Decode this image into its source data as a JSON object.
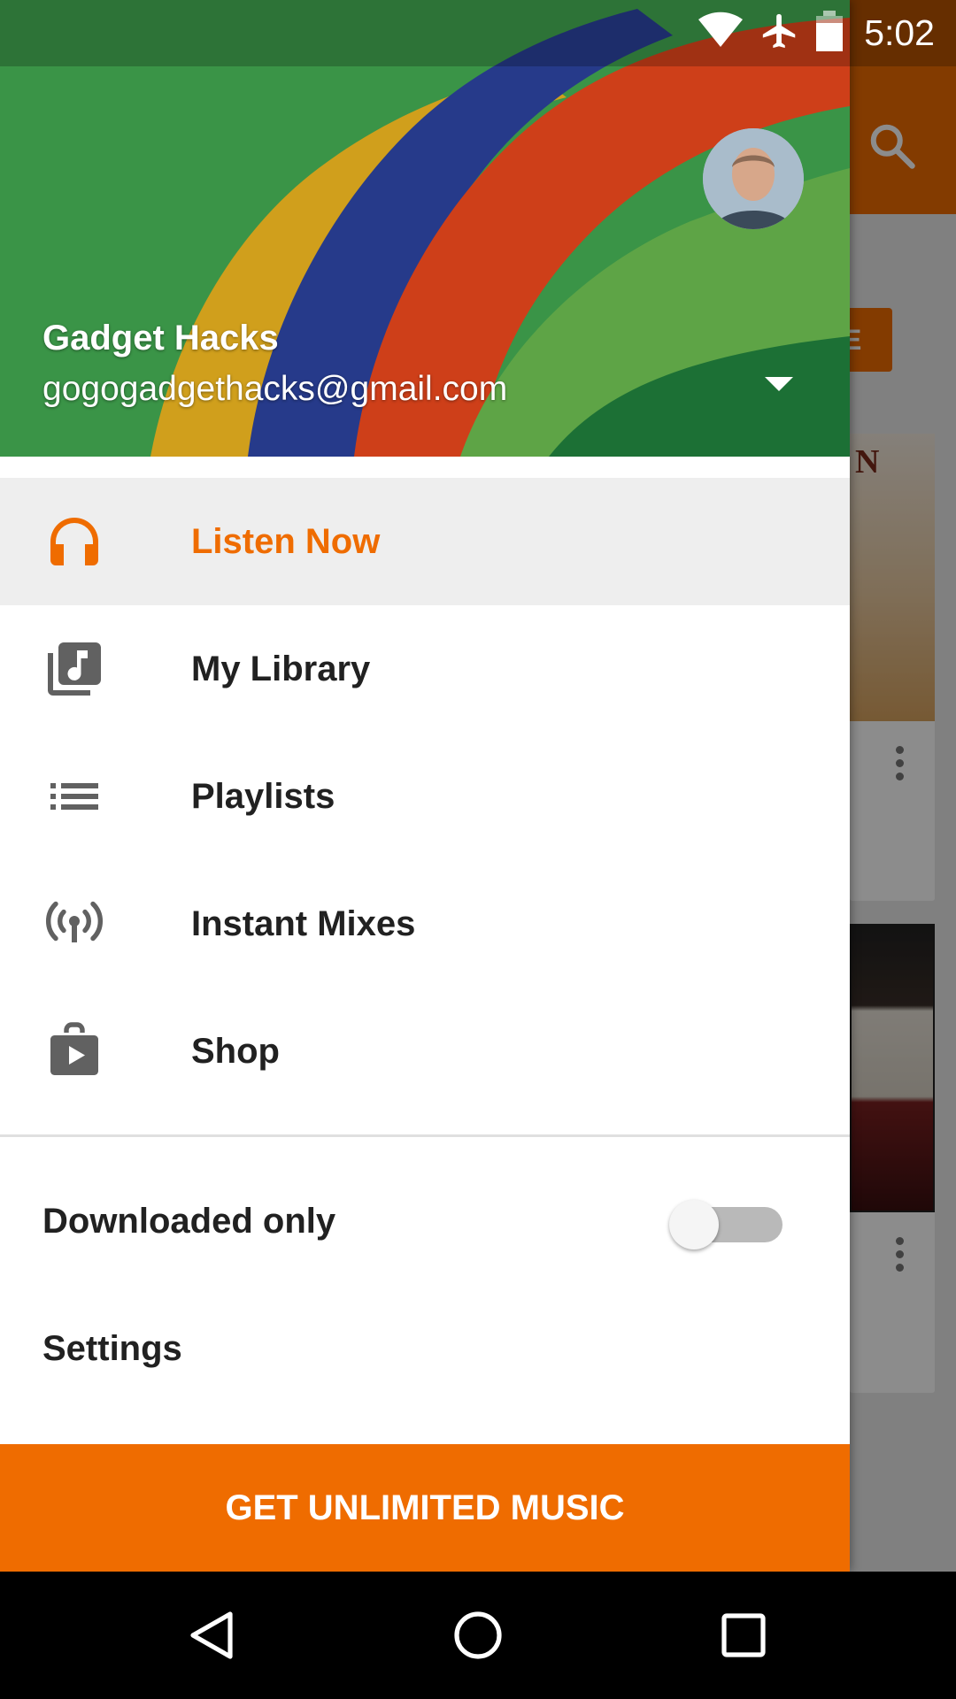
{
  "status_bar": {
    "time": "5:02",
    "icons": [
      "wifi-icon",
      "airplane-mode-icon",
      "battery-icon"
    ]
  },
  "background_app": {
    "icons": [
      "search-icon",
      "more-options-icon"
    ],
    "chip_label": "E",
    "card_letter": "N"
  },
  "drawer": {
    "account": {
      "name": "Gadget Hacks",
      "email": "gogogadgethacks@gmail.com",
      "toggle_icon": "arrow-drop-down-icon"
    },
    "nav": [
      {
        "label": "Listen Now",
        "icon": "headphones-icon",
        "active": true
      },
      {
        "label": "My Library",
        "icon": "library-music-icon",
        "active": false
      },
      {
        "label": "Playlists",
        "icon": "playlist-icon",
        "active": false
      },
      {
        "label": "Instant Mixes",
        "icon": "radio-broadcast-icon",
        "active": false
      },
      {
        "label": "Shop",
        "icon": "shop-bag-icon",
        "active": false
      }
    ],
    "downloaded_only": {
      "label": "Downloaded only",
      "enabled": false
    },
    "settings_label": "Settings",
    "cta_label": "GET UNLIMITED MUSIC"
  },
  "system_nav": {
    "buttons": [
      "back-icon",
      "home-icon",
      "recents-icon"
    ]
  },
  "colors": {
    "accent": "#ef6c00",
    "active_row": "#eeeeee",
    "text_primary": "#212121",
    "icon_gray": "#616161"
  }
}
